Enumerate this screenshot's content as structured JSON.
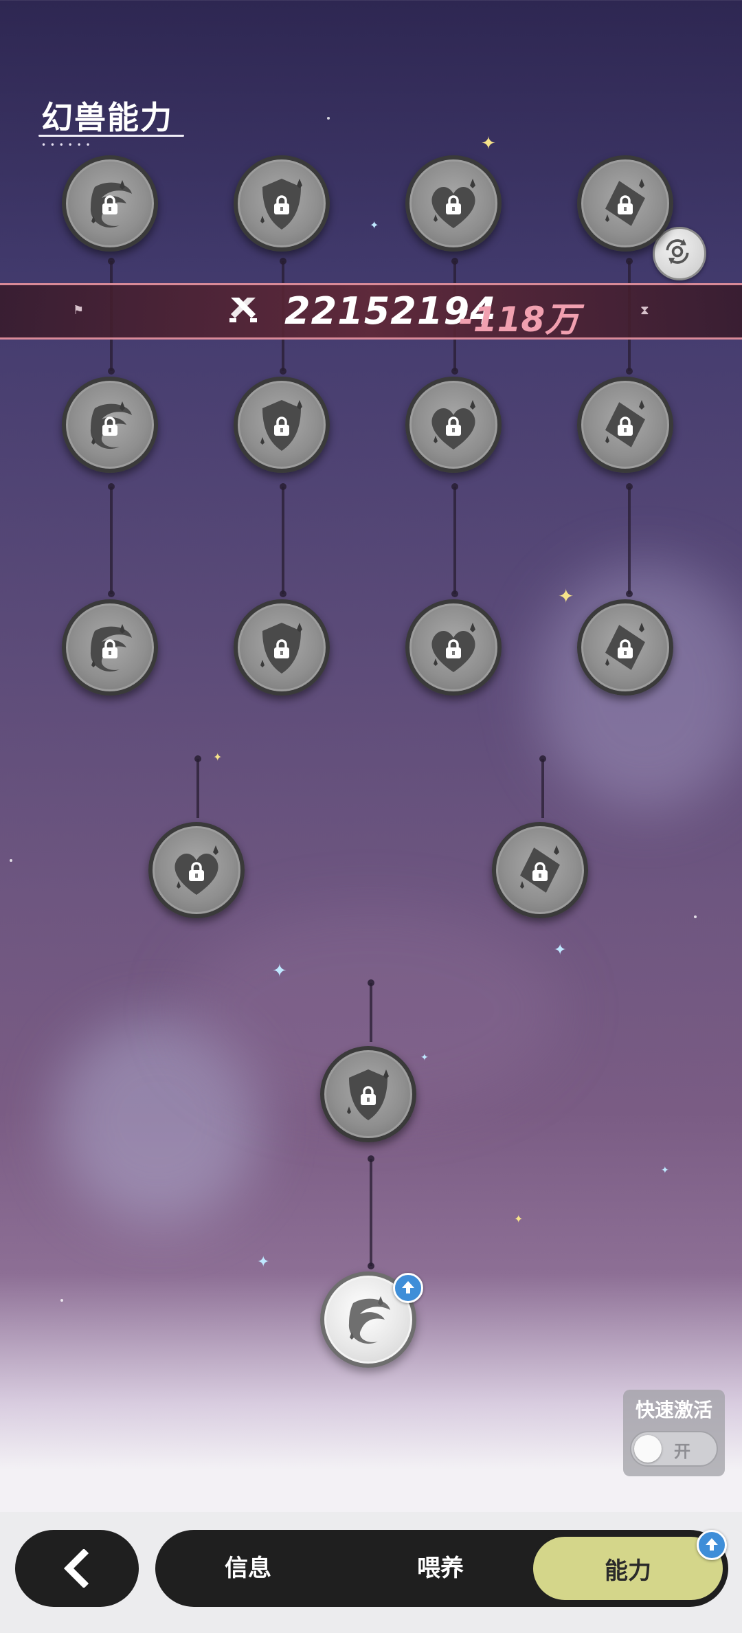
{
  "header": {
    "title": "幻兽能力"
  },
  "power": {
    "value": "22152194",
    "change": "-118万"
  },
  "tree": {
    "nodes": [
      {
        "name": "node-claw-1",
        "emblem": "claw",
        "locked": true
      },
      {
        "name": "node-shield-1",
        "emblem": "shield",
        "locked": true
      },
      {
        "name": "node-heart-1",
        "emblem": "heart",
        "locked": true
      },
      {
        "name": "node-diamond-1",
        "emblem": "diamond",
        "locked": true
      },
      {
        "name": "node-claw-2",
        "emblem": "claw",
        "locked": true
      },
      {
        "name": "node-shield-2",
        "emblem": "shield",
        "locked": true
      },
      {
        "name": "node-heart-2",
        "emblem": "heart",
        "locked": true
      },
      {
        "name": "node-diamond-2",
        "emblem": "diamond",
        "locked": true
      },
      {
        "name": "node-claw-3",
        "emblem": "claw",
        "locked": true
      },
      {
        "name": "node-shield-3",
        "emblem": "shield",
        "locked": true
      },
      {
        "name": "node-heart-3",
        "emblem": "heart",
        "locked": true
      },
      {
        "name": "node-diamond-3",
        "emblem": "diamond",
        "locked": true
      },
      {
        "name": "node-heart-4",
        "emblem": "heart",
        "locked": true
      },
      {
        "name": "node-diamond-4",
        "emblem": "diamond",
        "locked": true
      },
      {
        "name": "node-shield-4",
        "emblem": "shield",
        "locked": true
      },
      {
        "name": "node-claw-root",
        "emblem": "claw",
        "locked": false,
        "upgradable": true
      }
    ]
  },
  "quick_activate": {
    "label": "快速激活",
    "toggle_text": "开"
  },
  "nav": {
    "tabs": [
      {
        "label": "信息"
      },
      {
        "label": "喂养"
      },
      {
        "label": "能力",
        "active": true,
        "badge": "upgrade-arrow-icon"
      }
    ]
  },
  "colors": {
    "accent": "#d4d68a",
    "badge": "#3f8ed8",
    "power_change": "#f1a0b0"
  }
}
